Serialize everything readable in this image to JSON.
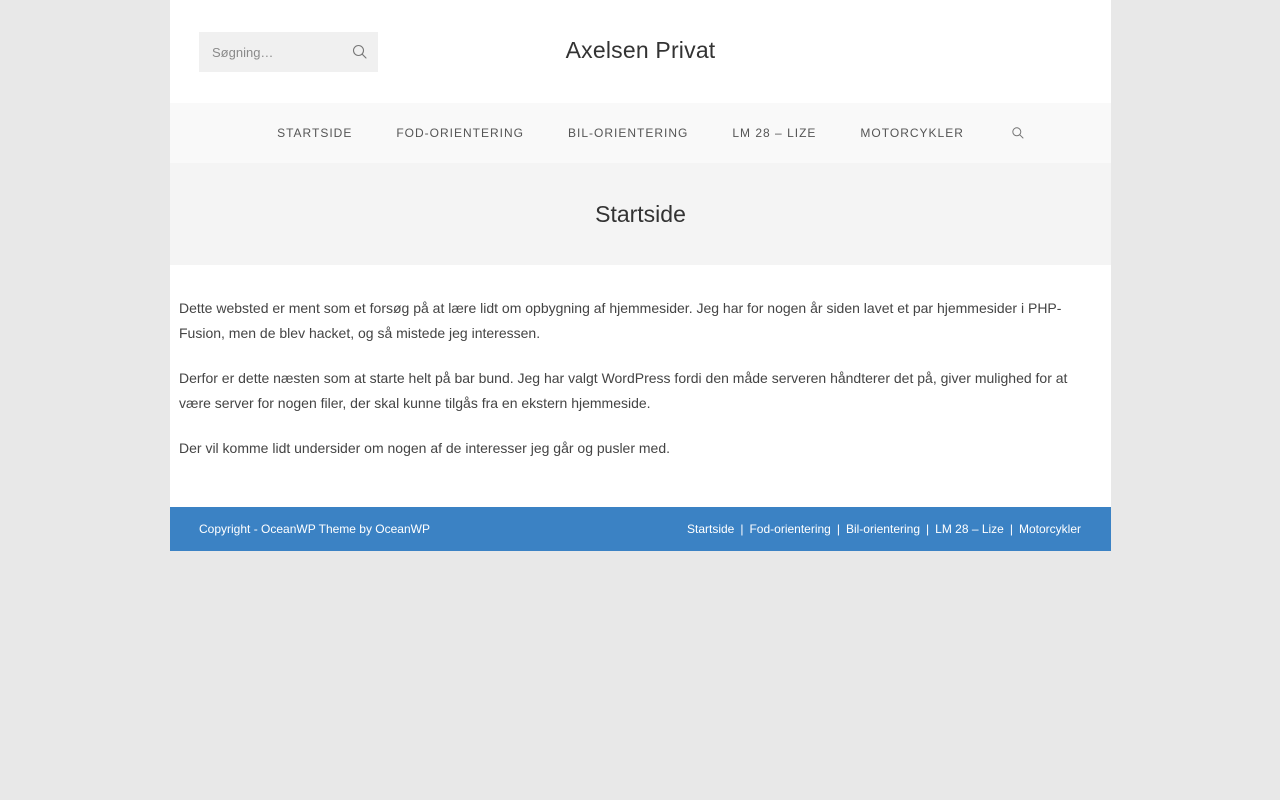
{
  "header": {
    "site_title": "Axelsen Privat",
    "search": {
      "placeholder": "Søgning…",
      "value": ""
    }
  },
  "nav": {
    "items": [
      {
        "label": "Startside"
      },
      {
        "label": "Fod-orientering"
      },
      {
        "label": "Bil-orientering"
      },
      {
        "label": "LM 28 – Lize"
      },
      {
        "label": "Motorcykler"
      }
    ]
  },
  "page": {
    "title": "Startside",
    "paragraphs": [
      "Dette websted er ment som et forsøg på at lære lidt om opbygning af hjemmesider. Jeg har for nogen år siden lavet et par hjemmesider i PHP-Fusion, men de blev hacket, og så mistede jeg interessen.",
      "Derfor er dette næsten som at starte helt på bar bund. Jeg har valgt WordPress fordi den måde serveren håndterer det på, giver mulighed for at være server for nogen filer, der skal kunne tilgås fra en ekstern hjemmeside.",
      "Der vil komme lidt undersider om nogen af de interesser jeg går og pusler med."
    ]
  },
  "footer": {
    "copyright": "Copyright - OceanWP Theme by OceanWP",
    "menu": [
      {
        "label": "Startside"
      },
      {
        "label": "Fod-orientering"
      },
      {
        "label": "Bil-orientering"
      },
      {
        "label": "LM 28 – Lize"
      },
      {
        "label": "Motorcykler"
      }
    ],
    "separator": "|"
  },
  "colors": {
    "background": "#e8e8e8",
    "footer_bg": "#3b82c4",
    "nav_bg": "#f9f9f9",
    "page_header_bg": "#f4f4f4"
  },
  "icons": {
    "header_search": "search-icon",
    "nav_search": "search-icon"
  }
}
